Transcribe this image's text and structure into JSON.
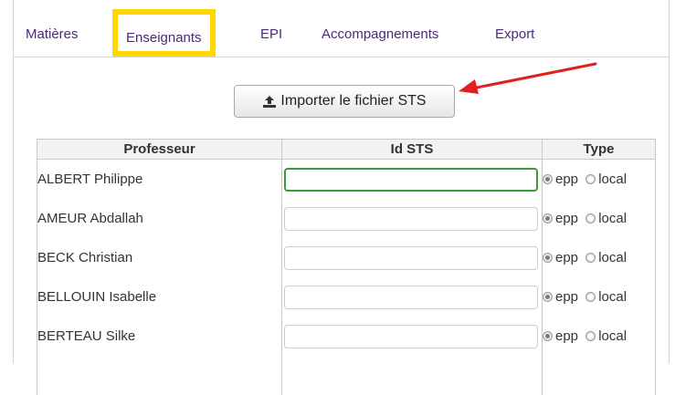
{
  "tabs": [
    {
      "label": "Matières",
      "active": false
    },
    {
      "label": "Enseignants",
      "active": true
    },
    {
      "label": "EPI",
      "active": false
    },
    {
      "label": "Accompagnements",
      "active": false
    },
    {
      "label": "Export",
      "active": false
    }
  ],
  "import_button": {
    "label": "Importer le fichier STS",
    "icon": "upload-icon"
  },
  "annotation": {
    "arrow_color": "#e02020",
    "highlight_color": "#ffd800"
  },
  "table": {
    "headers": {
      "professeur": "Professeur",
      "id_sts": "Id STS",
      "type": "Type"
    },
    "type_options": {
      "epp": "epp",
      "local": "local"
    },
    "rows": [
      {
        "name": "ALBERT Philippe",
        "id_sts": "",
        "type": "epp"
      },
      {
        "name": "AMEUR Abdallah",
        "id_sts": "",
        "type": "epp"
      },
      {
        "name": "BECK Christian",
        "id_sts": "",
        "type": "epp"
      },
      {
        "name": "BELLOUIN Isabelle",
        "id_sts": "",
        "type": "epp"
      },
      {
        "name": "BERTEAU Silke",
        "id_sts": "",
        "type": "epp"
      }
    ]
  }
}
